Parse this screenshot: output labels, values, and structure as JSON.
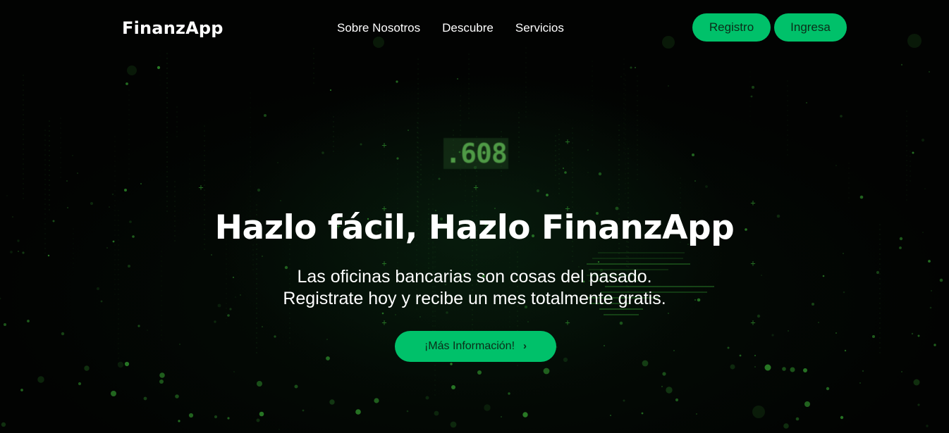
{
  "brand": "FinanzApp",
  "nav": {
    "links": [
      "Sobre Nosotros",
      "Descubre",
      "Servicios"
    ],
    "register_label": "Registro",
    "login_label": "Ingresa"
  },
  "hero": {
    "counter_text": ".608",
    "headline": "Hazlo fácil, Hazlo FinanzApp",
    "subtitle_lines": [
      "Las oficinas bancarias son cosas del pasado.",
      "Registrate hoy y recibe un mes totalmente gratis."
    ],
    "cta_label": "¡Más Información!",
    "cta_icon": "chevron-right-icon"
  },
  "colors": {
    "accent": "#00c16a",
    "accent_text": "#0b2d19",
    "background": "#020302",
    "matrix_green": "#3fbf3a"
  }
}
